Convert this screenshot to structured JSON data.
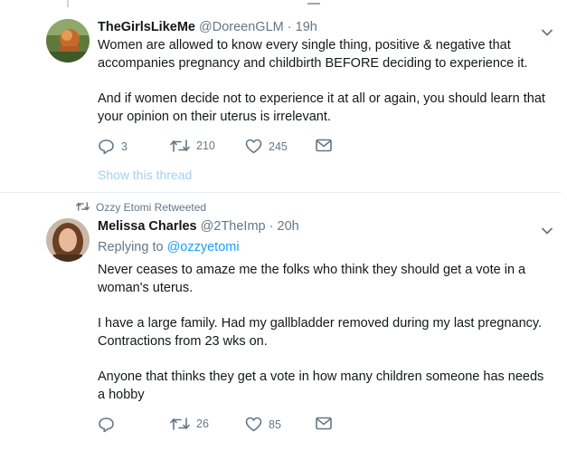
{
  "tweet1": {
    "display_name": "TheGirlsLikeMe",
    "handle": "@DoreenGLM",
    "separator": "·",
    "time": "19h",
    "paragraphs": [
      "Women are allowed to know every single thing, positive & negative that accompanies pregnancy and childbirth BEFORE deciding to experience it.",
      "And if women decide not to experience it at all or again, you should learn that your opinion on their uterus is irrelevant."
    ],
    "replies": "3",
    "retweets": "210",
    "likes": "245",
    "show_thread": "Show this thread"
  },
  "tweet2": {
    "retweeted_by": "Ozzy Etomi Retweeted",
    "display_name": "Melissa Charles",
    "handle": "@2TheImp",
    "separator": "·",
    "time": "20h",
    "replying_label": "Replying to",
    "replying_handle": "@ozzyetomi",
    "paragraphs": [
      "Never ceases to amaze me the folks who think they should get a vote in a woman's uterus.",
      "I have a large family. Had my gallbladder removed during my last pregnancy. Contractions from 23 wks on.",
      "Anyone that thinks they get a vote in how many children someone has needs a hobby"
    ],
    "retweets": "26",
    "likes": "85"
  },
  "icons": {
    "reply": "reply-icon",
    "retweet": "retweet-icon",
    "like": "heart-icon",
    "message": "envelope-icon",
    "caret": "chevron-down-icon"
  },
  "colors": {
    "accent": "#1da1f2",
    "muted": "#657786",
    "divider": "#e6ecf0"
  }
}
